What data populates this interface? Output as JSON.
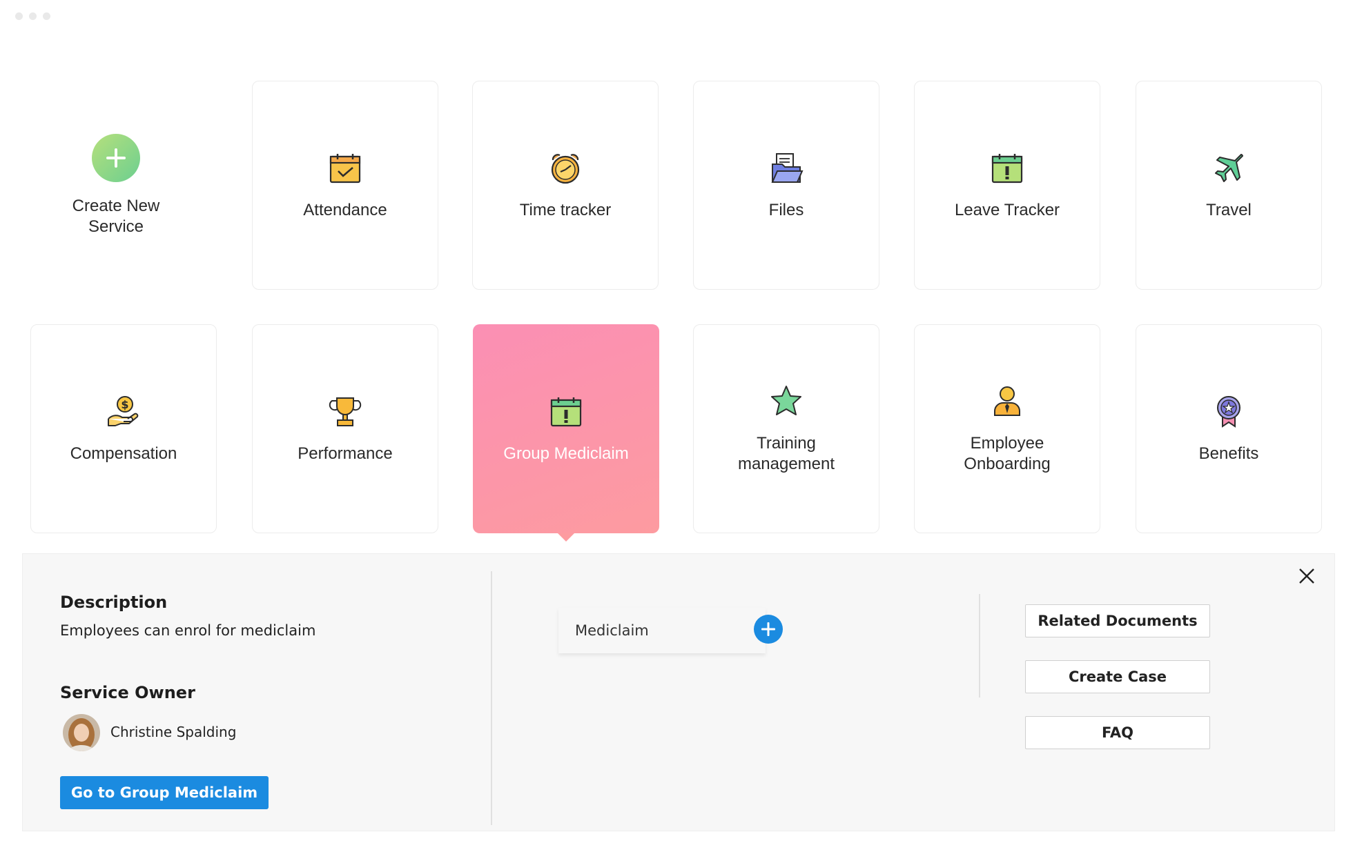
{
  "services": {
    "create_label": "Create New\nService",
    "tiles": [
      {
        "label": "Attendance",
        "icon": "calendar-check-icon"
      },
      {
        "label": "Time tracker",
        "icon": "alarm-clock-icon"
      },
      {
        "label": "Files",
        "icon": "folder-files-icon"
      },
      {
        "label": "Leave Tracker",
        "icon": "calendar-alert-icon"
      },
      {
        "label": "Travel",
        "icon": "airplane-icon"
      },
      {
        "label": "Compensation",
        "icon": "money-hand-icon"
      },
      {
        "label": "Performance",
        "icon": "trophy-icon"
      },
      {
        "label": "Group Mediclaim",
        "icon": "calendar-alert-icon"
      },
      {
        "label": "Training\nmanagement",
        "icon": "star-icon"
      },
      {
        "label": "Employee\nOnboarding",
        "icon": "person-icon"
      },
      {
        "label": "Benefits",
        "icon": "badge-ribbon-icon"
      }
    ],
    "selected": "Group Mediclaim",
    "active_color": "#fc94ab"
  },
  "detail": {
    "description_heading": "Description",
    "description_text": "Employees can enrol for mediclaim",
    "owner_heading": "Service Owner",
    "owner_name": "Christine Spalding",
    "go_button": "Go to Group Mediclaim",
    "form_chip": "Mediclaim",
    "related_documents": "Related Documents",
    "create_case": "Create Case",
    "faq": "FAQ",
    "accent_color": "#1b8be0"
  }
}
